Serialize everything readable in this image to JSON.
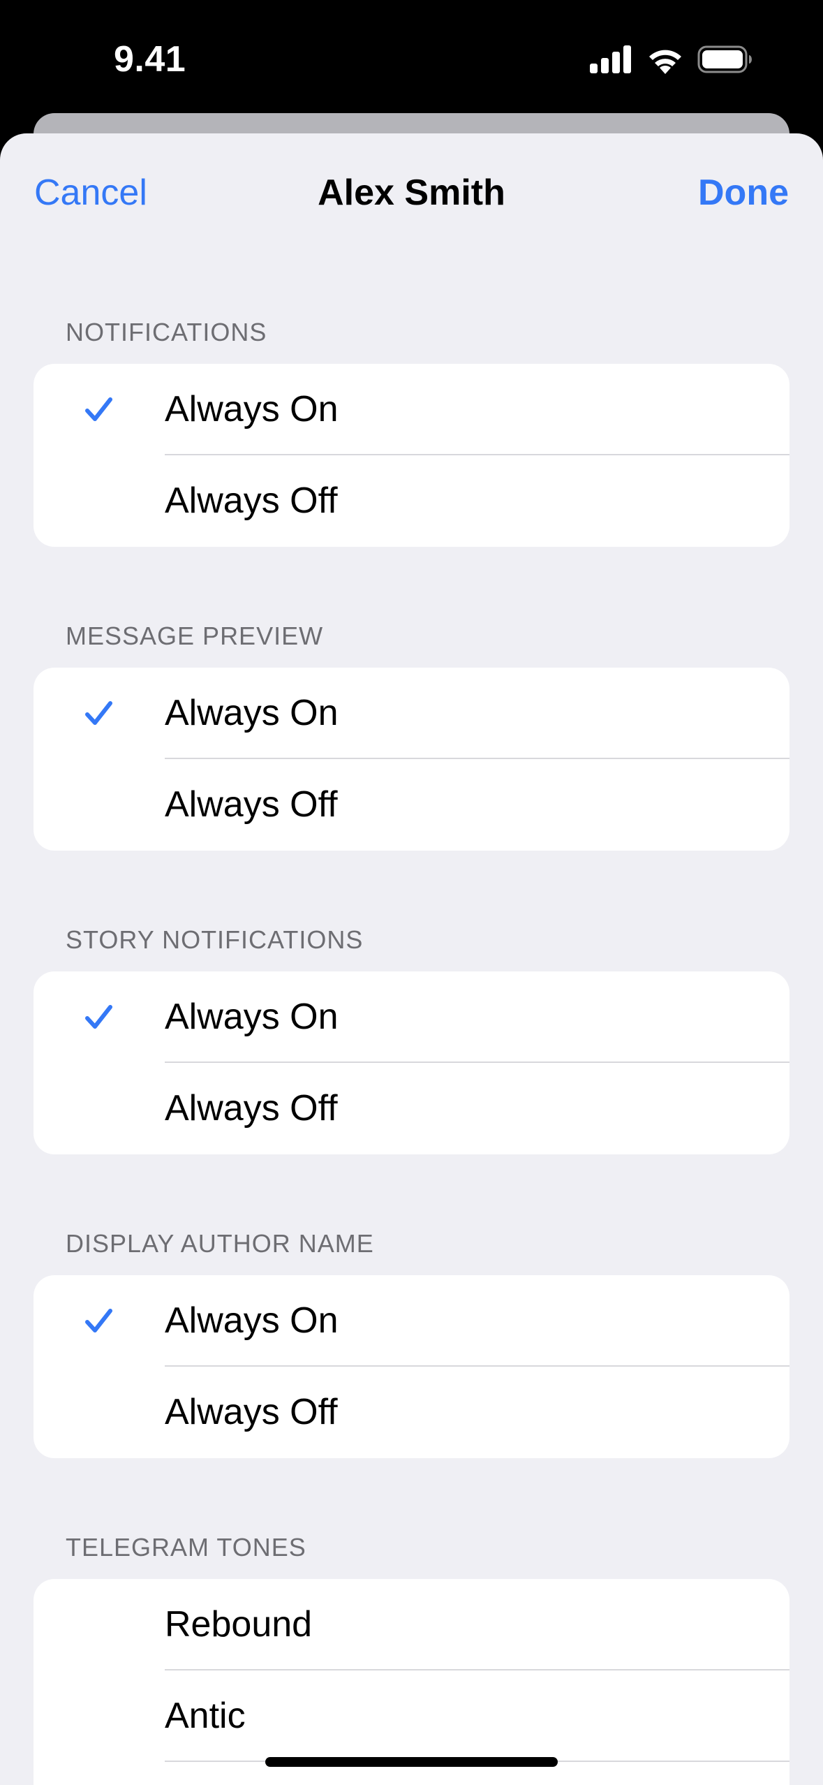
{
  "status_bar": {
    "time": "9.41",
    "icons": [
      "cellular-signal-icon",
      "wifi-icon",
      "battery-icon"
    ]
  },
  "nav": {
    "cancel_label": "Cancel",
    "title": "Alex Smith",
    "done_label": "Done"
  },
  "colors": {
    "accent": "#3478f6",
    "background": "#efeff4",
    "card": "#ffffff",
    "header_text": "#6d6d72"
  },
  "sections": {
    "notifications": {
      "header": "NOTIFICATIONS",
      "options": [
        {
          "label": "Always On",
          "selected": true
        },
        {
          "label": "Always Off",
          "selected": false
        }
      ]
    },
    "message_preview": {
      "header": "MESSAGE PREVIEW",
      "options": [
        {
          "label": "Always On",
          "selected": true
        },
        {
          "label": "Always Off",
          "selected": false
        }
      ]
    },
    "story_notifications": {
      "header": "STORY NOTIFICATIONS",
      "options": [
        {
          "label": "Always On",
          "selected": true
        },
        {
          "label": "Always Off",
          "selected": false
        }
      ]
    },
    "display_author_name": {
      "header": "DISPLAY AUTHOR NAME",
      "options": [
        {
          "label": "Always On",
          "selected": true
        },
        {
          "label": "Always Off",
          "selected": false
        }
      ]
    },
    "telegram_tones": {
      "header": "TELEGRAM TONES",
      "options": [
        {
          "label": "Rebound",
          "selected": false
        },
        {
          "label": "Antic",
          "selected": false
        }
      ]
    }
  }
}
